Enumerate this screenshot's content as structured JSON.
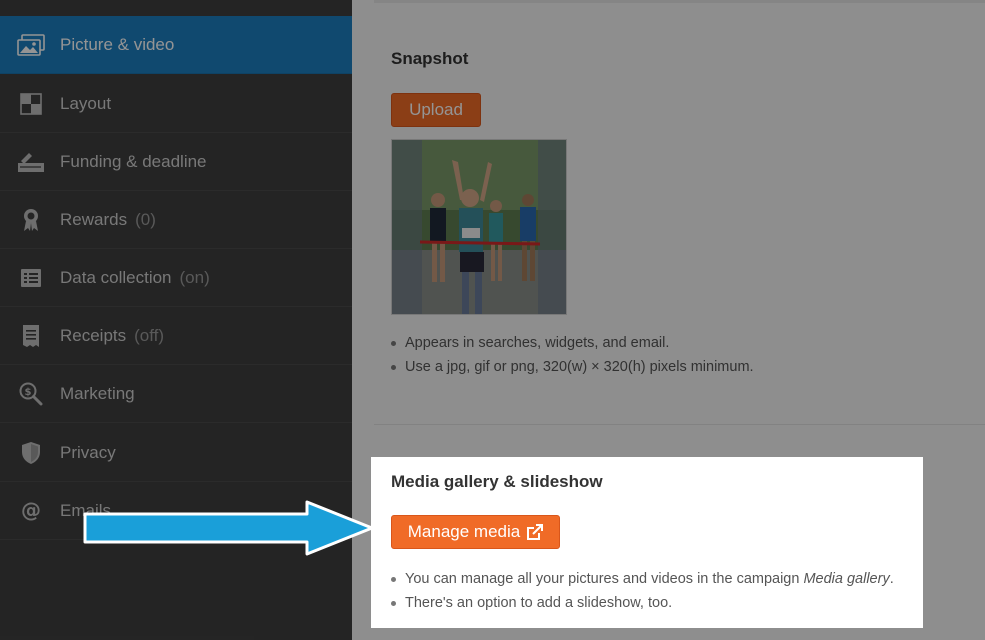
{
  "sidebar": {
    "items": [
      {
        "label": "Picture & video",
        "count": "",
        "icon": "image-icon",
        "active": true
      },
      {
        "label": "Layout",
        "count": "",
        "icon": "layout-icon"
      },
      {
        "label": "Funding & deadline",
        "count": "",
        "icon": "funding-icon"
      },
      {
        "label": "Rewards",
        "count": "(0)",
        "icon": "ribbon-icon"
      },
      {
        "label": "Data collection",
        "count": "(on)",
        "icon": "list-icon"
      },
      {
        "label": "Receipts",
        "count": "(off)",
        "icon": "receipt-icon"
      },
      {
        "label": "Marketing",
        "count": "",
        "icon": "marketing-icon"
      },
      {
        "label": "Privacy",
        "count": "",
        "icon": "shield-icon"
      },
      {
        "label": "Emails",
        "count": "",
        "icon": "at-icon"
      }
    ]
  },
  "snapshot": {
    "title": "Snapshot",
    "upload_label": "Upload",
    "bullets": [
      "Appears in searches, widgets, and email.",
      "Use a jpg, gif or png, 320(w) × 320(h) pixels minimum."
    ]
  },
  "gallery": {
    "title": "Media gallery & slideshow",
    "manage_label": "Manage media",
    "bullet1_prefix": "You can manage all your pictures and videos in the campaign ",
    "bullet1_em": "Media gallery",
    "bullet1_suffix": ".",
    "bullet2": "There's an option to add a slideshow, too."
  },
  "colors": {
    "accent": "#f06b27",
    "sidebar_active": "#1d7fc0",
    "arrow": "#1a9fd9"
  }
}
